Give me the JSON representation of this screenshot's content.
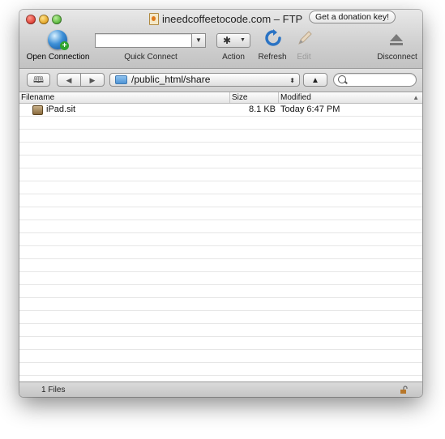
{
  "window": {
    "title": "ineedcoffeetocode.com – FTP",
    "donation_label": "Get a donation key!"
  },
  "toolbar": {
    "open_connection": "Open Connection",
    "quick_connect": "Quick Connect",
    "quick_connect_value": "",
    "action": "Action",
    "refresh": "Refresh",
    "edit": "Edit",
    "disconnect": "Disconnect"
  },
  "pathbar": {
    "path": "/public_html/share",
    "search_value": ""
  },
  "table": {
    "columns": [
      "Filename",
      "Size",
      "Modified"
    ],
    "rows": [
      {
        "name": "iPad.sit",
        "size": "8.1 KB",
        "modified": "Today 6:47 PM"
      }
    ]
  },
  "status": {
    "count": "1 Files"
  },
  "colors": {
    "accent_blue": "#3d8fd6",
    "row_stripe": "#e6e6e6"
  }
}
